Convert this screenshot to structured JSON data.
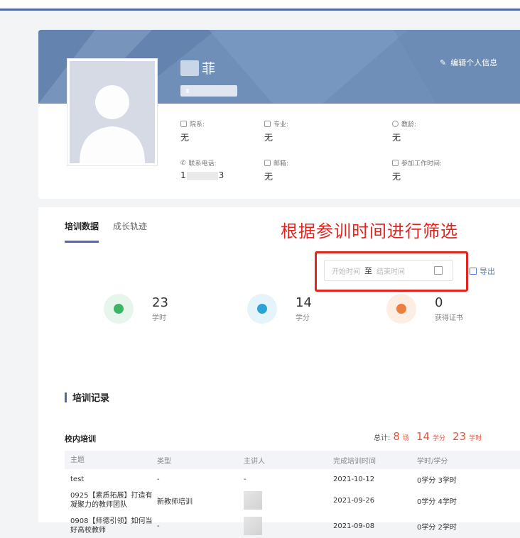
{
  "profile": {
    "name_visible": "菲",
    "edit_label": "编辑个人信息",
    "fields": [
      {
        "label": "院系:",
        "value": "无",
        "icon": "building-icon"
      },
      {
        "label": "专业:",
        "value": "无",
        "icon": "book-icon"
      },
      {
        "label": "教龄:",
        "value": "无",
        "icon": "hat-icon"
      },
      {
        "label": "联系电话:",
        "value_prefix": "1",
        "value_suffix": "3",
        "icon": "phone-icon"
      },
      {
        "label": "邮箱:",
        "value": "无",
        "icon": "mail-icon"
      },
      {
        "label": "参加工作时间:",
        "value": "无",
        "icon": "briefcase-icon"
      }
    ]
  },
  "tabs": [
    "培训数据",
    "成长轨迹"
  ],
  "annotation": "根据参训时间进行筛选",
  "date_filter": {
    "start_placeholder": "开始时间",
    "separator": "至",
    "end_placeholder": "结束时间"
  },
  "export_label": "导出",
  "stats": [
    {
      "value": "23",
      "unit": "学时",
      "color": "#3db565",
      "bg": "#e7f6ec"
    },
    {
      "value": "14",
      "unit": "学分",
      "color": "#2ba3d6",
      "bg": "#e5f3fa"
    },
    {
      "value": "0",
      "unit": "获得证书",
      "color": "#ef7d3c",
      "bg": "#fdeee4"
    }
  ],
  "section_title": "培训记录",
  "campus_title": "校内培训",
  "totals": {
    "label": "总计:",
    "sessions": "8",
    "sessions_unit": "场",
    "credits": "14",
    "credits_unit": "学分",
    "hours": "23",
    "hours_unit": "学时"
  },
  "table": {
    "headers": [
      "主题",
      "类型",
      "主讲人",
      "完成培训时间",
      "学时/学分"
    ],
    "rows": [
      {
        "topic": "test",
        "type": "-",
        "speaker": "-",
        "date": "2021-10-12",
        "credit": "0学分 3学时"
      },
      {
        "topic": "0925【素质拓展】打造有凝聚力的教师团队",
        "type": "新教师培训",
        "speaker": "",
        "date": "2021-09-26",
        "credit": "0学分 4学时"
      },
      {
        "topic": "0908【师德引领】如何当好高校教师",
        "type": "-",
        "speaker": "",
        "date": "2021-09-08",
        "credit": "0学分 2学时"
      }
    ]
  }
}
